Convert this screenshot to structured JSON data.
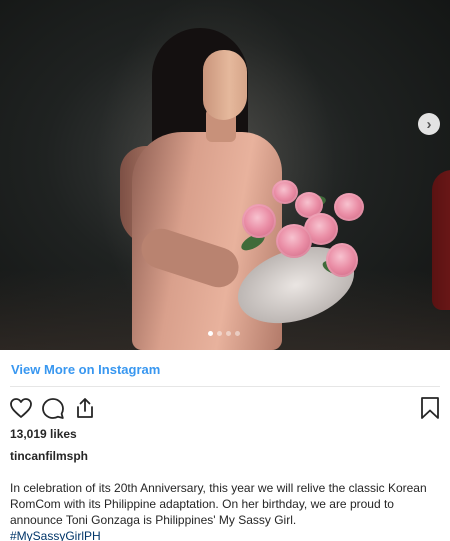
{
  "carousel": {
    "slide_count": 4,
    "active_slide": 1,
    "next_icon": "chevron-right-icon"
  },
  "post": {
    "view_more_label": "View More on Instagram",
    "likes_text": "13,019 likes",
    "username": "tincanfilmsph",
    "caption": "In celebration of its 20th Anniversary, this year we will relive the classic Korean RomCom with its Philippine adaptation. On her birthday, we are proud to announce Toni Gonzaga is Philippines' My Sassy Girl.",
    "hashtag": "#MySassyGirlPH"
  },
  "actions": {
    "like_icon": "heart-icon",
    "comment_icon": "comment-icon",
    "share_icon": "share-icon",
    "save_icon": "bookmark-icon"
  },
  "colors": {
    "link": "#3897f0",
    "hashtag": "#003569",
    "text": "#262626"
  }
}
